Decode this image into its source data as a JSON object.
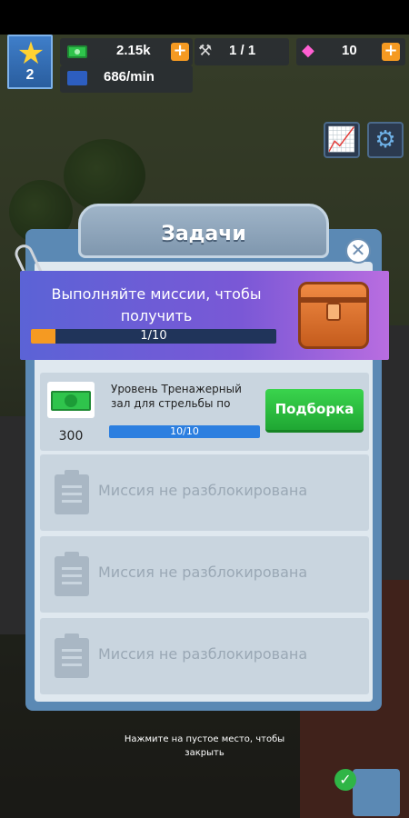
{
  "hud": {
    "level": "2",
    "cash": "2.15k",
    "builders": "1 / 1",
    "gems": "10",
    "income_rate": "686/min"
  },
  "dialog": {
    "title": "Задачи",
    "banner_text": "Выполняйте миссии, чтобы получить",
    "banner_progress_text": "1/10",
    "banner_progress": 0.1
  },
  "missions": [
    {
      "title": "Уровень Тренажерный зал для стрельбы по",
      "reward": "300",
      "progress_text": "10/10",
      "progress": 1.0,
      "button": "Подборка"
    },
    {
      "locked_text": "Миссия не разблокирована"
    },
    {
      "locked_text": "Миссия не разблокирована"
    },
    {
      "locked_text": "Миссия не разблокирована"
    }
  ],
  "hint": {
    "line1": "Нажмите на пустое место, чтобы",
    "line2": "закрыть"
  }
}
